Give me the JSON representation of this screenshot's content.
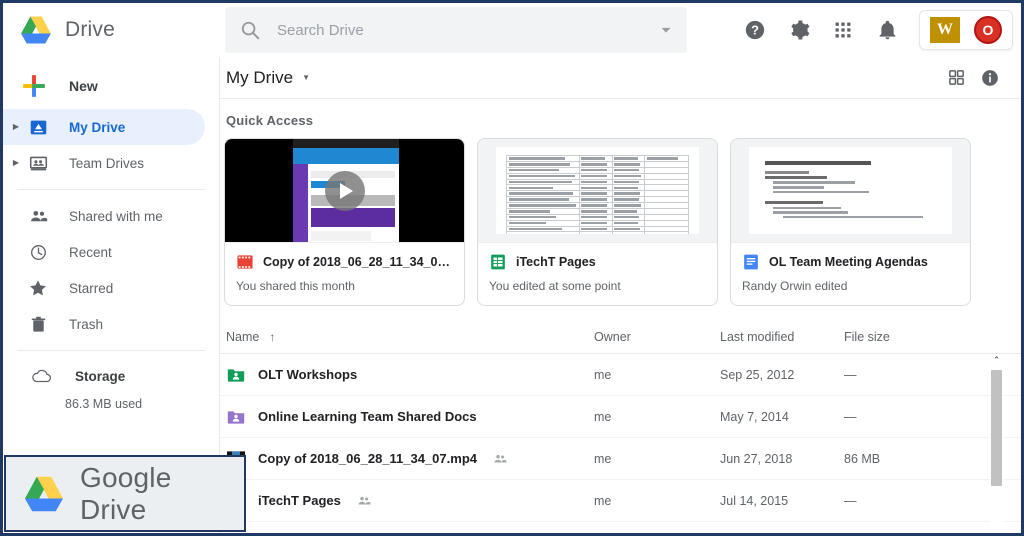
{
  "app": {
    "brand_title": "Drive",
    "logo_icon": "google-drive-logo"
  },
  "search": {
    "placeholder": "Search Drive",
    "value": "",
    "icon": "search-icon",
    "options_icon": "chevron-down-icon"
  },
  "top_actions": {
    "help_icon": "help-circle-icon",
    "settings_icon": "gear-icon",
    "apps_icon": "apps-grid-icon",
    "notifications_icon": "bell-icon",
    "workspace_badge": "W",
    "account_avatar": "O"
  },
  "sidebar": {
    "new_button": {
      "label": "New",
      "icon": "plus-icon"
    },
    "items": [
      {
        "label": "My Drive",
        "icon": "my-drive-icon",
        "active": true,
        "expandable": true
      },
      {
        "label": "Team Drives",
        "icon": "team-drives-icon",
        "active": false,
        "expandable": true
      },
      {
        "label": "Shared with me",
        "icon": "people-icon",
        "active": false,
        "expandable": false
      },
      {
        "label": "Recent",
        "icon": "clock-icon",
        "active": false,
        "expandable": false
      },
      {
        "label": "Starred",
        "icon": "star-icon",
        "active": false,
        "expandable": false
      },
      {
        "label": "Trash",
        "icon": "trash-icon",
        "active": false,
        "expandable": false
      }
    ],
    "storage": {
      "label": "Storage",
      "used": "86.3 MB used",
      "icon": "cloud-icon"
    }
  },
  "breadcrumb": {
    "title": "My Drive",
    "caret_icon": "chevron-down-icon",
    "grid_view_icon": "grid-view-icon",
    "info_icon": "info-circle-icon"
  },
  "quick_access": {
    "title": "Quick Access",
    "cards": [
      {
        "name": "Copy of 2018_06_28_11_34_07.mp4",
        "subtitle": "You shared this month",
        "type": "video",
        "file_icon": "video-file-icon",
        "play_icon": "play-icon"
      },
      {
        "name": "iTechT Pages",
        "subtitle": "You edited at some point",
        "type": "sheet",
        "file_icon": "google-sheets-icon"
      },
      {
        "name": "OL Team Meeting Agendas",
        "subtitle": "Randy Orwin edited",
        "type": "doc",
        "file_icon": "google-docs-icon"
      }
    ]
  },
  "file_table": {
    "columns": {
      "name": "Name",
      "owner": "Owner",
      "modified": "Last modified",
      "size": "File size"
    },
    "sort_arrow": "↑",
    "rows": [
      {
        "name": "OLT Workshops",
        "icon": "shared-folder-green-icon",
        "shared": false,
        "owner": "me",
        "modified": "Sep 25, 2012",
        "size": "—"
      },
      {
        "name": "Online Learning Team Shared Docs",
        "icon": "shared-folder-purple-icon",
        "shared": false,
        "owner": "me",
        "modified": "May 7, 2014",
        "size": "—"
      },
      {
        "name": "Copy of 2018_06_28_11_34_07.mp4",
        "icon": "video-thumb-icon",
        "shared": true,
        "owner": "me",
        "modified": "Jun 27, 2018",
        "size": "86 MB"
      },
      {
        "name": "iTechT Pages",
        "icon": "google-sheets-icon",
        "shared": true,
        "owner": "me",
        "modified": "Jul 14, 2015",
        "size": "—"
      }
    ],
    "scrollbar": {
      "up_arrow": "⌃"
    }
  },
  "watermark": {
    "text_primary": "Google",
    "text_secondary": "Drive",
    "logo_icon": "google-drive-logo"
  },
  "colors": {
    "border": "#1f3864",
    "accent_blue": "#1967d2",
    "active_bg": "#e8f0fe",
    "badge_gold": "#bf9000",
    "avatar_red": "#d93025",
    "folder_green": "#0f9d58",
    "folder_purple": "#9575cd",
    "sheets_green": "#0f9d58",
    "docs_blue": "#4285f4"
  }
}
